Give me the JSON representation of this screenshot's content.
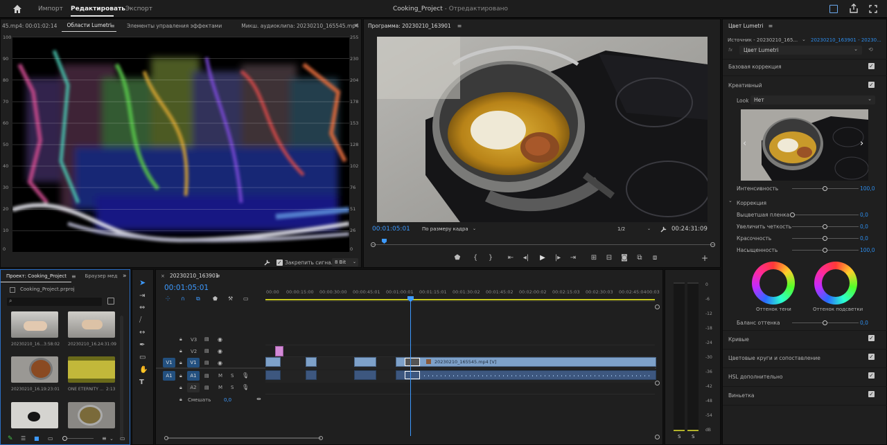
{
  "topbar": {
    "home_icon": "home-icon",
    "tabs": [
      {
        "label": "Импорт"
      },
      {
        "label": "Редактировать"
      },
      {
        "label": "Экспорт"
      }
    ],
    "project_title": "Cooking_Project",
    "edit_status": "- Отредактировано"
  },
  "scopes": {
    "tabs": [
      {
        "label": "45.mp4: 00:01:02:14"
      },
      {
        "label": "Области Lumetri"
      },
      {
        "label": "Элементы управления эффектами"
      },
      {
        "label": "Микш. аудиоклипа: 20230210_165545.mp4"
      }
    ],
    "left_scale": [
      "100",
      "90",
      "80",
      "70",
      "60",
      "50",
      "40",
      "30",
      "20",
      "10",
      "0"
    ],
    "right_scale": [
      "255",
      "230",
      "204",
      "178",
      "153",
      "128",
      "102",
      "76",
      "51",
      "26",
      "0"
    ],
    "clamp_label": "Закрепить сигнал",
    "bit_depth": "8 Bit"
  },
  "program": {
    "title": "Программа: 20230210_163901",
    "timecode": "00:01:05:01",
    "fit_label": "По размеру кадра",
    "resolution": "1/2",
    "duration": "00:24:31:09"
  },
  "lumetri": {
    "title": "Цвет Lumetri",
    "source_label": "Источник - 20230210_165...",
    "seq_label": "20230210_163901 - 20230...",
    "fx_label": "fx",
    "effect_name": "Цвет Lumetri",
    "basic": "Базовая коррекция",
    "creative": "Креативный",
    "look_label": "Look",
    "look_value": "Нет",
    "intensity_label": "Интенсивность",
    "intensity_value": "100,0",
    "correction_label": "Коррекция",
    "params": [
      {
        "label": "Выцветшая пленка",
        "value": "0,0",
        "level": 0
      },
      {
        "label": "Увеличить четкость",
        "value": "0,0",
        "level": 0.5
      },
      {
        "label": "Красочность",
        "value": "0,0",
        "level": 0.5
      },
      {
        "label": "Насыщенность",
        "value": "100,0",
        "level": 0.5
      }
    ],
    "shadow_tint": "Оттенок тени",
    "highlight_tint": "Оттенок подсветки",
    "tint_balance_label": "Баланс оттенка",
    "tint_balance_value": "0,0",
    "sections": [
      {
        "label": "Кривые"
      },
      {
        "label": "Цветовые круги и сопоставление"
      },
      {
        "label": "HSL дополнительно"
      },
      {
        "label": "Виньетка"
      }
    ]
  },
  "project": {
    "tabs": [
      {
        "label": "Проект: Cooking_Project"
      },
      {
        "label": "Браузер мед"
      }
    ],
    "file_name": "Cooking_Project.prproj",
    "items": [
      {
        "name": "20230210_16...",
        "duration": "3:58:02"
      },
      {
        "name": "20230210_16...",
        "duration": "24:31:09"
      },
      {
        "name": "20230210_16...",
        "duration": "19:23:01"
      },
      {
        "name": "ONE ETERNITY ...",
        "duration": "2:13"
      },
      {
        "name": "",
        "duration": ""
      },
      {
        "name": "",
        "duration": ""
      }
    ]
  },
  "timeline": {
    "title": "20230210_163901",
    "timecode": "00:01:05:01",
    "ruler": [
      "00:00",
      "00:00:15:00",
      "00:00:30:00",
      "00:00:45:01",
      "00:01:00:01",
      "00:01:15:01",
      "00:01:30:02",
      "00:01:45:02",
      "00:02:00:02",
      "00:02:15:03",
      "00:02:30:03",
      "00:02:45:04",
      "00:03"
    ],
    "tracks": {
      "v3": "V3",
      "v2": "V2",
      "v1": "V1",
      "a1": "A1",
      "a2": "A2",
      "mix": "Смешать",
      "mix_value": "0,0",
      "m": "M",
      "s": "S"
    },
    "clip_label": "20230210_165545.mp4 [V]"
  },
  "audio_meter": {
    "scale": [
      "0",
      "-6",
      "-12",
      "-18",
      "-24",
      "-30",
      "-36",
      "-42",
      "-48",
      "-54",
      "dB"
    ],
    "solo_left": "S",
    "solo_right": "S"
  }
}
